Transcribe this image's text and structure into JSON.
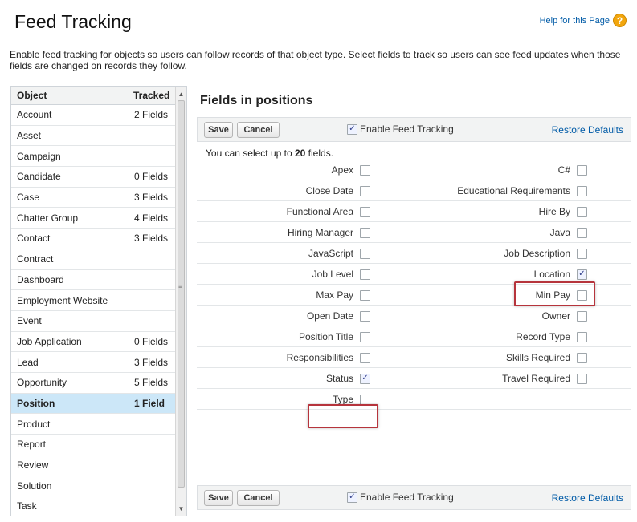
{
  "page": {
    "title": "Feed Tracking",
    "help_link": "Help for this Page",
    "help_icon": "question-icon",
    "description": "Enable feed tracking for objects so users can follow records of that object type. Select fields to track so users can see feed updates when those fields are changed on records they follow."
  },
  "objects": {
    "header_object": "Object",
    "header_tracked": "Tracked",
    "items": [
      {
        "name": "Account",
        "tracked": "2 Fields"
      },
      {
        "name": "Asset",
        "tracked": ""
      },
      {
        "name": "Campaign",
        "tracked": ""
      },
      {
        "name": "Candidate",
        "tracked": "0 Fields"
      },
      {
        "name": "Case",
        "tracked": "3 Fields"
      },
      {
        "name": "Chatter Group",
        "tracked": "4 Fields"
      },
      {
        "name": "Contact",
        "tracked": "3 Fields"
      },
      {
        "name": "Contract",
        "tracked": ""
      },
      {
        "name": "Dashboard",
        "tracked": ""
      },
      {
        "name": "Employment Website",
        "tracked": ""
      },
      {
        "name": "Event",
        "tracked": ""
      },
      {
        "name": "Job Application",
        "tracked": "0 Fields"
      },
      {
        "name": "Lead",
        "tracked": "3 Fields"
      },
      {
        "name": "Opportunity",
        "tracked": "5 Fields"
      },
      {
        "name": "Position",
        "tracked": "1 Field",
        "selected": true
      },
      {
        "name": "Product",
        "tracked": ""
      },
      {
        "name": "Report",
        "tracked": ""
      },
      {
        "name": "Review",
        "tracked": ""
      },
      {
        "name": "Solution",
        "tracked": ""
      },
      {
        "name": "Task",
        "tracked": ""
      }
    ]
  },
  "fields_panel": {
    "title": "Fields in positions",
    "save_label": "Save",
    "cancel_label": "Cancel",
    "enable_label": "Enable Feed Tracking",
    "enable_checked": true,
    "restore_label": "Restore Defaults",
    "limit_prefix": "You can select up to ",
    "limit_count": "20",
    "limit_suffix": " fields.",
    "rows": [
      {
        "left": "Apex",
        "left_checked": false,
        "right": "C#",
        "right_checked": false
      },
      {
        "left": "Close Date",
        "left_checked": false,
        "right": "Educational Requirements",
        "right_checked": false
      },
      {
        "left": "Functional Area",
        "left_checked": false,
        "right": "Hire By",
        "right_checked": false
      },
      {
        "left": "Hiring Manager",
        "left_checked": false,
        "right": "Java",
        "right_checked": false
      },
      {
        "left": "JavaScript",
        "left_checked": false,
        "right": "Job Description",
        "right_checked": false
      },
      {
        "left": "Job Level",
        "left_checked": false,
        "right": "Location",
        "right_checked": true
      },
      {
        "left": "Max Pay",
        "left_checked": false,
        "right": "Min Pay",
        "right_checked": false
      },
      {
        "left": "Open Date",
        "left_checked": false,
        "right": "Owner",
        "right_checked": false
      },
      {
        "left": "Position Title",
        "left_checked": false,
        "right": "Record Type",
        "right_checked": false
      },
      {
        "left": "Responsibilities",
        "left_checked": false,
        "right": "Skills Required",
        "right_checked": false
      },
      {
        "left": "Status",
        "left_checked": true,
        "right": "Travel Required",
        "right_checked": false
      },
      {
        "left": "Type",
        "left_checked": false,
        "right": "",
        "right_checked": false
      }
    ]
  },
  "colors": {
    "link": "#015ba7",
    "selected_row": "#cce7f8",
    "highlight_box": "#b6343c",
    "help_icon": "#f2a60d"
  }
}
